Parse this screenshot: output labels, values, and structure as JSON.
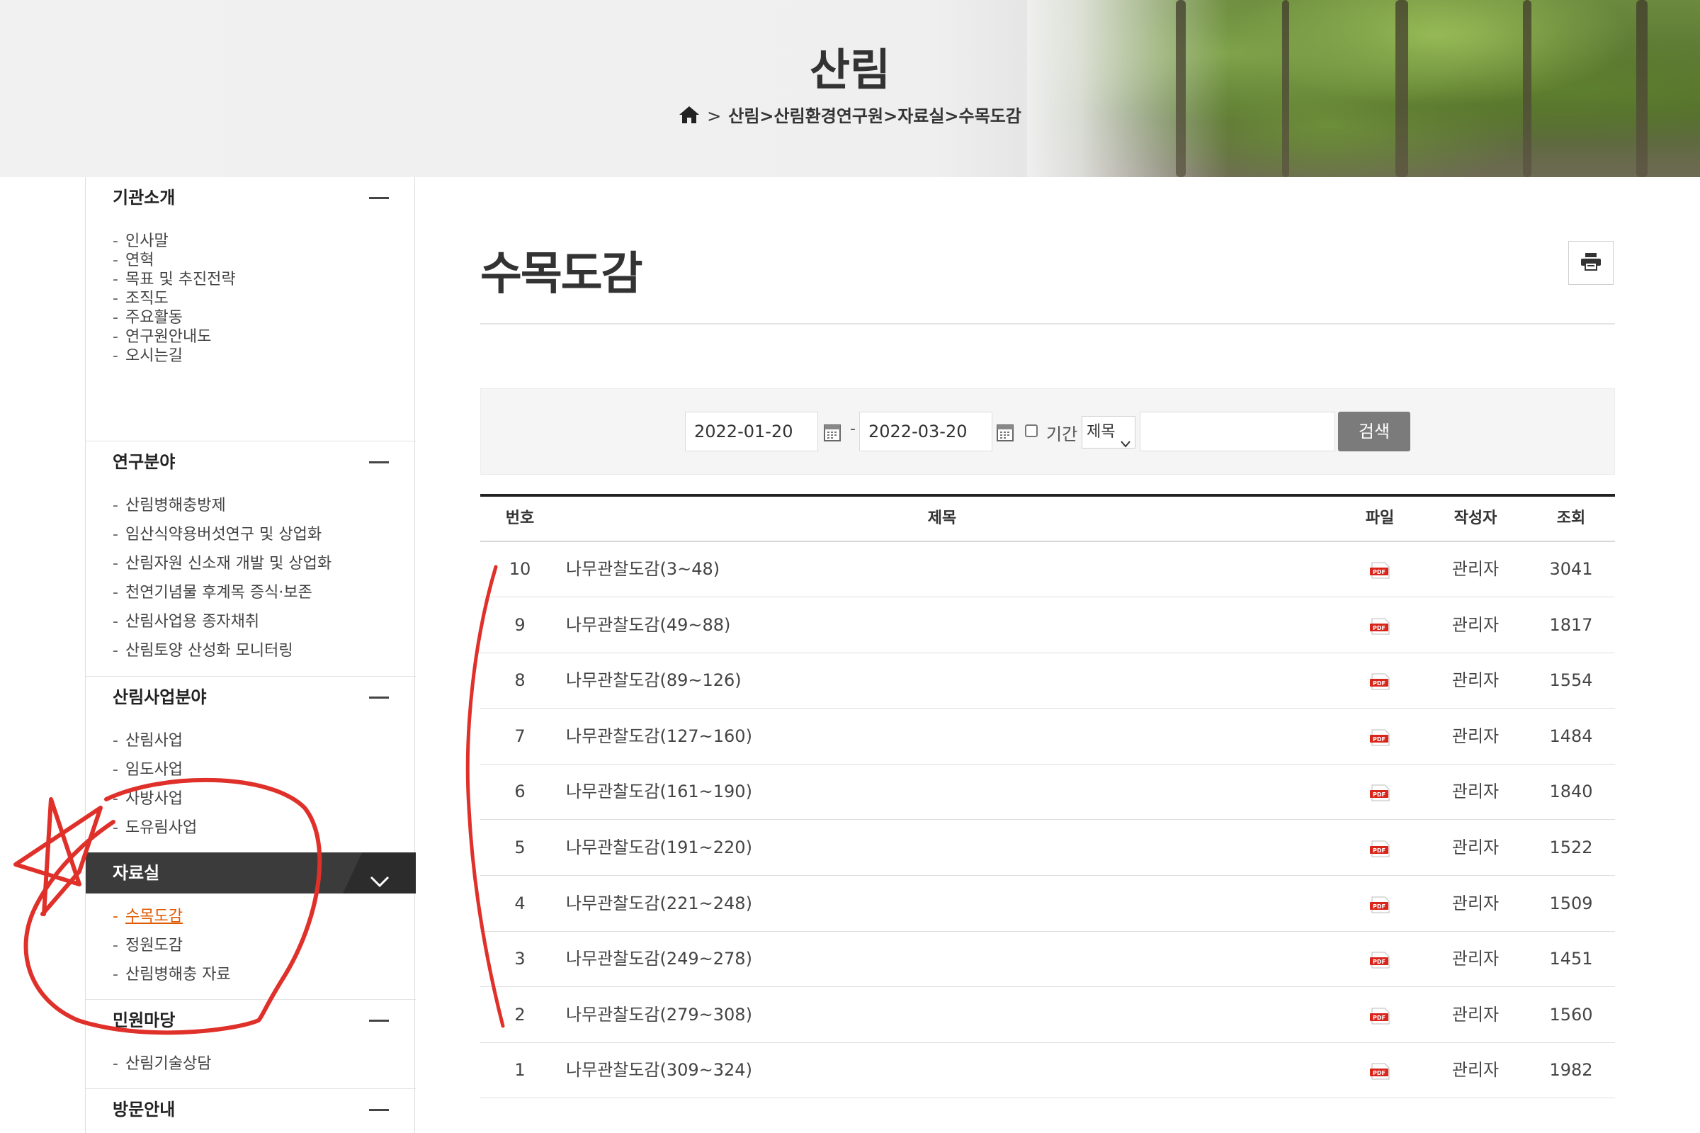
{
  "header": {
    "title": "산림",
    "breadcrumb": "산림>산림환경연구원>자료실>수목도감",
    "breadcrumb_arrow": ">"
  },
  "sidebar": {
    "groups": [
      {
        "title": "기관소개",
        "items": [
          "인사말",
          "연혁",
          "목표 및 추진전략",
          "조직도",
          "주요활동",
          "연구원안내도",
          "오시는길"
        ]
      },
      {
        "title": "연구분야",
        "items": [
          "산림병해충방제",
          "임산식약용버섯연구 및 상업화",
          "산림자원 신소재 개발 및 상업화",
          "천연기념물 후계목 증식·보존",
          "산림사업용 종자채취",
          "산림토양 산성화 모니터링"
        ]
      },
      {
        "title": "산림사업분야",
        "items": [
          "산림사업",
          "임도사업",
          "사방사업",
          "도유림사업"
        ]
      },
      {
        "title": "자료실",
        "items": [
          "수목도감",
          "정원도감",
          "산림병해충 자료"
        ]
      },
      {
        "title": "민원마당",
        "items": [
          "산림기술상담"
        ]
      },
      {
        "title": "방문안내",
        "items": []
      }
    ],
    "bullet": "-"
  },
  "main": {
    "title": "수목도감",
    "search": {
      "start_date": "2022-01-20",
      "end_date": "2022-03-20",
      "date_separator": "-",
      "period_label": "기간",
      "field_select": "제목",
      "keyword": "",
      "button": "검색"
    },
    "table": {
      "headers": {
        "no": "번호",
        "title": "제목",
        "file": "파일",
        "author": "작성자",
        "views": "조회"
      },
      "file_badge": "PDF",
      "rows": [
        {
          "no": "10",
          "title": "나무관찰도감(3~48)",
          "author": "관리자",
          "views": "3041"
        },
        {
          "no": "9",
          "title": "나무관찰도감(49~88)",
          "author": "관리자",
          "views": "1817"
        },
        {
          "no": "8",
          "title": "나무관찰도감(89~126)",
          "author": "관리자",
          "views": "1554"
        },
        {
          "no": "7",
          "title": "나무관찰도감(127~160)",
          "author": "관리자",
          "views": "1484"
        },
        {
          "no": "6",
          "title": "나무관찰도감(161~190)",
          "author": "관리자",
          "views": "1840"
        },
        {
          "no": "5",
          "title": "나무관찰도감(191~220)",
          "author": "관리자",
          "views": "1522"
        },
        {
          "no": "4",
          "title": "나무관찰도감(221~248)",
          "author": "관리자",
          "views": "1509"
        },
        {
          "no": "3",
          "title": "나무관찰도감(249~278)",
          "author": "관리자",
          "views": "1451"
        },
        {
          "no": "2",
          "title": "나무관찰도감(279~308)",
          "author": "관리자",
          "views": "1560"
        },
        {
          "no": "1",
          "title": "나무관찰도감(309~324)",
          "author": "관리자",
          "views": "1982"
        }
      ]
    }
  },
  "colors": {
    "accent_current": "#e15a00",
    "active_menu_bg": "#3b3b3b",
    "annotation_red": "#e0302a",
    "pdf_red": "#d9261c"
  }
}
